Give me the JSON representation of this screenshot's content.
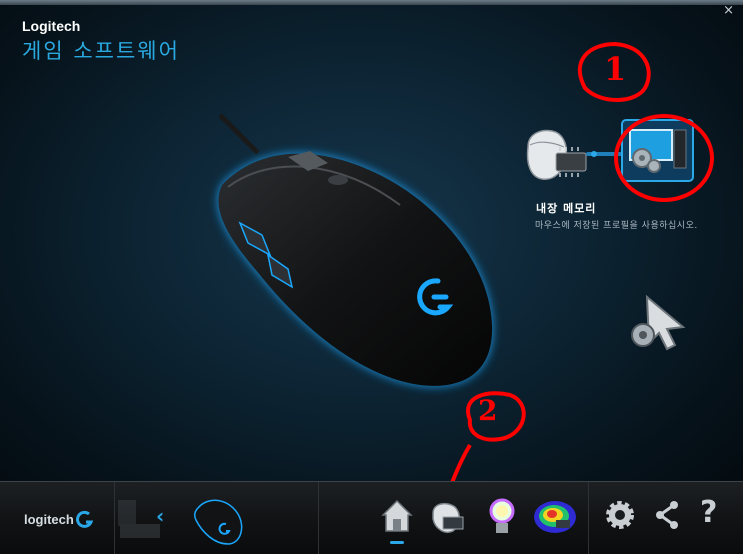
{
  "window": {
    "close_glyph": "×"
  },
  "header": {
    "brand": "Logitech",
    "title": "게임 소프트웨어"
  },
  "profile_mode": {
    "title": "내장 메모리",
    "description": "마우스에 저장된 프로필을 사용하십시오.",
    "icons": [
      "onboard-memory-mouse-icon",
      "computer-settings-icon",
      "pointer-settings-icon"
    ]
  },
  "annotations": {
    "first": "1",
    "second": "2",
    "color": "#ff0000"
  },
  "footer": {
    "logo_text": "logitech",
    "nav_chevron": "‹",
    "help_glyph": "?",
    "icons": [
      "home-icon",
      "customize-buttons-icon",
      "lighting-icon",
      "heatmap-icon",
      "settings-icon",
      "share-icon",
      "help-icon"
    ]
  },
  "colors": {
    "accent": "#29a9e0",
    "background": "#0c2332",
    "annotation": "#ff0000"
  }
}
